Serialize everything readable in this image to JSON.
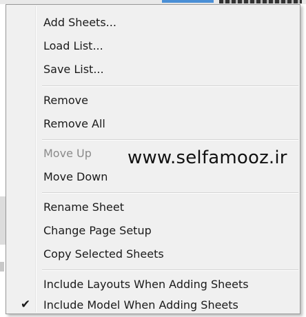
{
  "menu": {
    "groups": [
      {
        "items": [
          {
            "label": "Add Sheets...",
            "enabled": true,
            "checked": false
          },
          {
            "label": "Load List...",
            "enabled": true,
            "checked": false
          },
          {
            "label": "Save List...",
            "enabled": true,
            "checked": false
          }
        ]
      },
      {
        "items": [
          {
            "label": "Remove",
            "enabled": true,
            "checked": false
          },
          {
            "label": "Remove All",
            "enabled": true,
            "checked": false
          }
        ]
      },
      {
        "items": [
          {
            "label": "Move Up",
            "enabled": false,
            "checked": false
          },
          {
            "label": "Move Down",
            "enabled": true,
            "checked": false
          }
        ]
      },
      {
        "items": [
          {
            "label": "Rename Sheet",
            "enabled": true,
            "checked": false
          },
          {
            "label": "Change Page Setup",
            "enabled": true,
            "checked": false
          },
          {
            "label": "Copy Selected Sheets",
            "enabled": true,
            "checked": false
          }
        ]
      },
      {
        "items": [
          {
            "label": "Include Layouts When Adding Sheets",
            "enabled": true,
            "checked": false
          },
          {
            "label": "Include Model When Adding Sheets",
            "enabled": true,
            "checked": true,
            "check_glyph": "✔"
          }
        ]
      }
    ]
  },
  "watermark": {
    "text": "www.selfamooz.ir"
  },
  "colors": {
    "menu_bg": "#f0f0f0",
    "text": "#1a1a1a",
    "disabled_text": "#8a8a8a",
    "separator": "#d4d4d4"
  }
}
